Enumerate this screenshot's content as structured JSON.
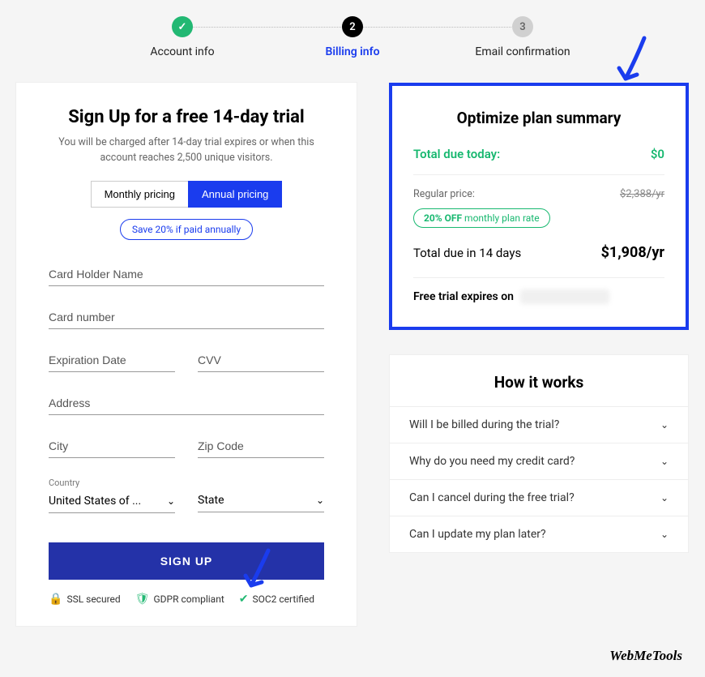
{
  "stepper": {
    "steps": [
      {
        "label": "Account info",
        "status": "completed"
      },
      {
        "label": "Billing info",
        "status": "active",
        "num": "2"
      },
      {
        "label": "Email confirmation",
        "status": "upcoming",
        "num": "3"
      }
    ]
  },
  "signup": {
    "title": "Sign Up for a free 14-day trial",
    "subtext": "You will be charged after 14-day trial expires or when this account reaches 2,500 unique visitors.",
    "toggle": {
      "monthly": "Monthly pricing",
      "annual": "Annual pricing"
    },
    "save_pill": "Save 20% if paid annually",
    "fields": {
      "card_holder": "Card Holder Name",
      "card_number": "Card number",
      "expiration": "Expiration Date",
      "cvv": "CVV",
      "address": "Address",
      "city": "City",
      "zip": "Zip Code",
      "country_label": "Country",
      "country_value": "United States of ...",
      "state": "State"
    },
    "signup_btn": "SIGN UP",
    "trust": {
      "ssl": "SSL secured",
      "gdpr": "GDPR compliant",
      "soc2": "SOC2 certified"
    }
  },
  "summary": {
    "title": "Optimize plan summary",
    "due_today_label": "Total due today:",
    "due_today_value": "$0",
    "regular_label": "Regular price:",
    "regular_value": "$2,388/yr",
    "discount_bold": "20% OFF",
    "discount_rest": " monthly plan rate",
    "due_label": "Total due in 14 days",
    "due_value": "$1,908/yr",
    "expiry_label": "Free trial expires on"
  },
  "how": {
    "title": "How it works",
    "items": [
      "Will I be billed during the trial?",
      "Why do you need my credit card?",
      "Can I cancel during the free trial?",
      "Can I update my plan later?"
    ]
  },
  "watermark": "WebMeTools"
}
